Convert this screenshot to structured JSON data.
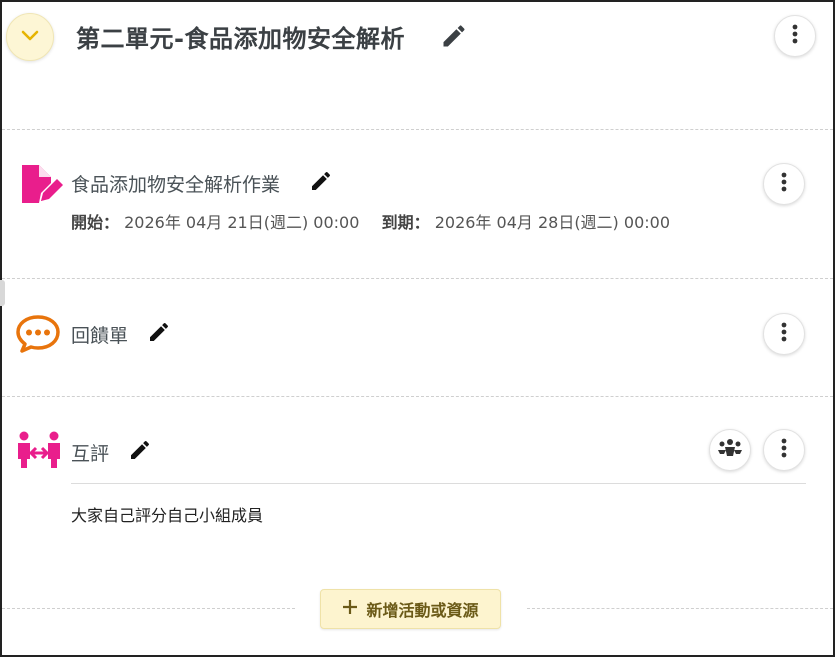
{
  "section": {
    "title": "第二單元-食品添加物安全解析"
  },
  "activities": [
    {
      "title": "食品添加物安全解析作業",
      "start_label": "開始：",
      "start_value": "2026年 04月 21日(週二) 00:00",
      "due_label": "到期：",
      "due_value": "2026年 04月 28日(週二) 00:00",
      "icon": "assignment-icon"
    },
    {
      "title": "回饋單",
      "icon": "feedback-icon"
    },
    {
      "title": "互評",
      "description": "大家自己評分自己小組成員",
      "icon": "peer-review-icon"
    }
  ],
  "add_button": {
    "label": "新增活動或資源"
  },
  "colors": {
    "assignment": "#e91e8c",
    "feedback": "#e8740c",
    "peer_review": "#e91e8c",
    "add_button_bg": "#fdf4cf"
  }
}
